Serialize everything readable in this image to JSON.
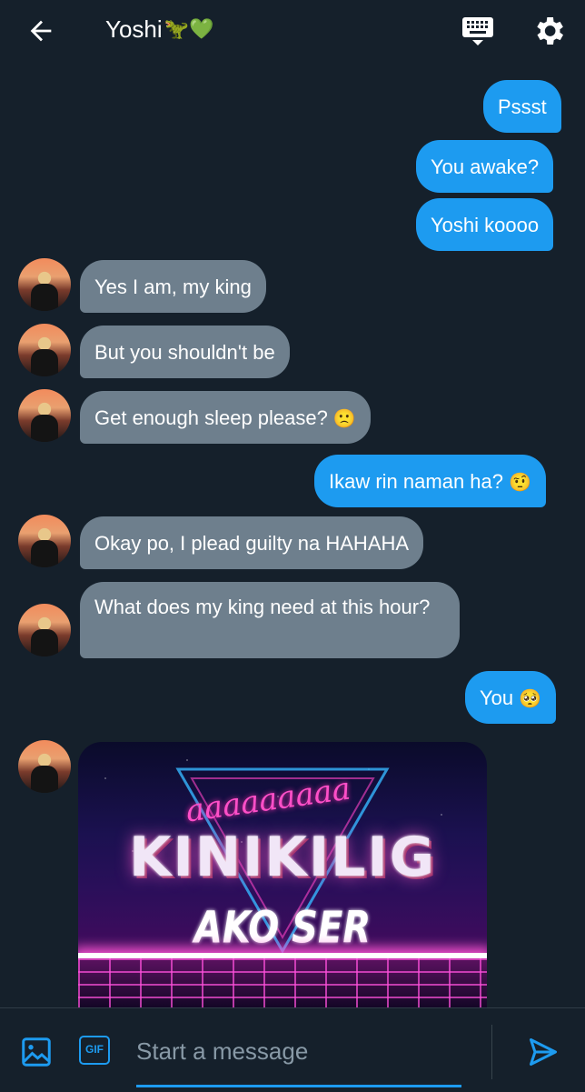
{
  "header": {
    "title": "Yoshi",
    "title_emojis": "🦖💚",
    "back_icon": "back-arrow-icon",
    "keyboard_icon": "keyboard-icon",
    "settings_icon": "gear-icon"
  },
  "messages": [
    {
      "from": "me",
      "text": "Pssst"
    },
    {
      "from": "me",
      "text": "You awake?"
    },
    {
      "from": "me",
      "text": "Yoshi koooo"
    },
    {
      "from": "them",
      "text": "Yes I am, my king"
    },
    {
      "from": "them",
      "text": "But you shouldn't be"
    },
    {
      "from": "them",
      "text": "Get enough sleep please?",
      "emoji": "🙁"
    },
    {
      "from": "me",
      "text": "Ikaw rin naman ha?",
      "emoji": "🤨"
    },
    {
      "from": "them",
      "text": "Okay po, I plead guilty na HAHAHA"
    },
    {
      "from": "them",
      "text": "What does my king need at this hour?"
    },
    {
      "from": "me",
      "text": "You",
      "emoji": "🥺"
    }
  ],
  "media": {
    "script_text": "aaaaaaaaa",
    "big_text": "KINIKILIG",
    "small_text": "AKO SER"
  },
  "composer": {
    "image_icon": "image-icon",
    "gif_label": "GIF",
    "placeholder": "Start a message",
    "send_icon": "send-icon"
  },
  "colors": {
    "background": "#15202b",
    "outgoing_bubble": "#1d9bf0",
    "incoming_bubble": "#6e7f8d",
    "accent": "#1d9bf0"
  }
}
